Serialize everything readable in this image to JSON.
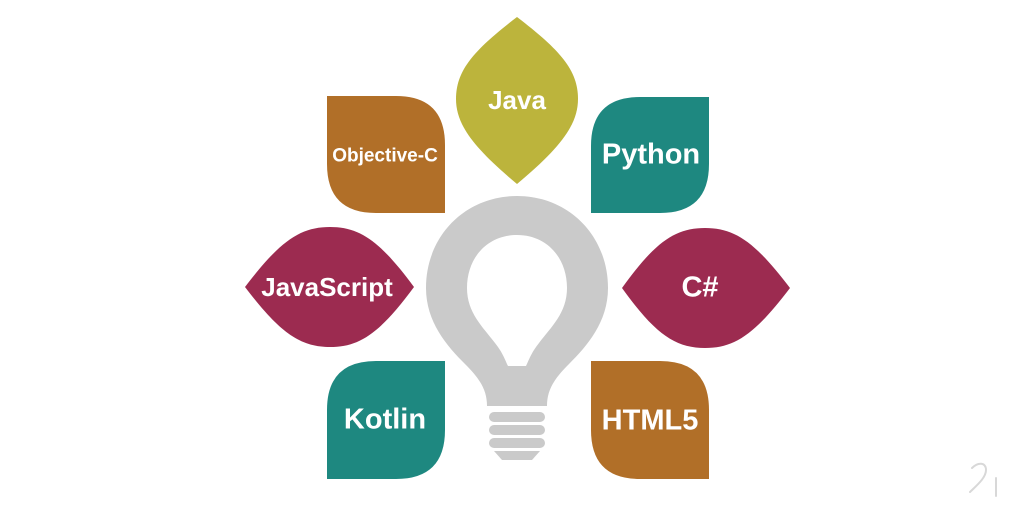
{
  "diagram": {
    "petals": [
      {
        "key": "java",
        "label": "Java",
        "color": "#bcb43c"
      },
      {
        "key": "python",
        "label": "Python",
        "color": "#1e8880"
      },
      {
        "key": "csharp",
        "label": "C#",
        "color": "#9c2b50"
      },
      {
        "key": "html5",
        "label": "HTML5",
        "color": "#b16f28"
      },
      {
        "key": "kotlin",
        "label": "Kotlin",
        "color": "#1e8880"
      },
      {
        "key": "javascript",
        "label": "JavaScript",
        "color": "#9c2b50"
      },
      {
        "key": "objective-c",
        "label": "Objective-C",
        "color": "#b16f28"
      }
    ],
    "center_icon": "lightbulb-icon",
    "bulb_color": "#cacaca"
  }
}
